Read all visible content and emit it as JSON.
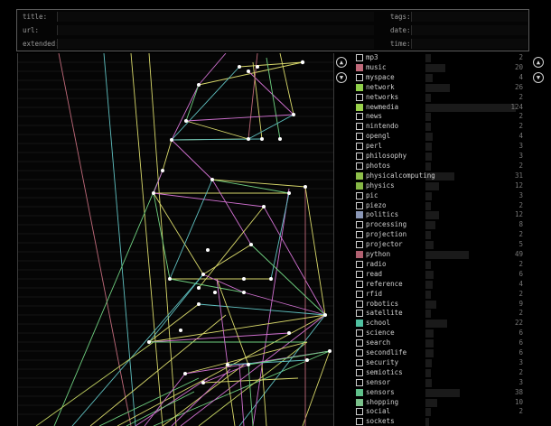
{
  "fields": {
    "title": "title:",
    "url": "url:",
    "extended": "extended:",
    "tags": "tags:",
    "date": "date:",
    "time": "time:"
  },
  "tags": [
    {
      "name": "mp3",
      "count": "2",
      "color": null
    },
    {
      "name": "music",
      "count": "20",
      "color": "#c06a7a"
    },
    {
      "name": "myspace",
      "count": "4",
      "color": null
    },
    {
      "name": "network",
      "count": "26",
      "color": "#8fcf4a"
    },
    {
      "name": "networks",
      "count": "2",
      "color": null
    },
    {
      "name": "newmedia",
      "count": "124",
      "color": "#9ad24b"
    },
    {
      "name": "news",
      "count": "2",
      "color": null
    },
    {
      "name": "nintendo",
      "count": "2",
      "color": null
    },
    {
      "name": "opengl",
      "count": "4",
      "color": null
    },
    {
      "name": "perl",
      "count": "3",
      "color": null
    },
    {
      "name": "philosophy",
      "count": "3",
      "color": null
    },
    {
      "name": "photos",
      "count": "2",
      "color": null
    },
    {
      "name": "physicalcomputing",
      "count": "31",
      "color": "#8fc04a"
    },
    {
      "name": "physics",
      "count": "12",
      "color": "#86b745"
    },
    {
      "name": "pic",
      "count": "3",
      "color": null
    },
    {
      "name": "piezo",
      "count": "2",
      "color": null
    },
    {
      "name": "politics",
      "count": "12",
      "color": "#8a97b6"
    },
    {
      "name": "processing",
      "count": "8",
      "color": null
    },
    {
      "name": "projection",
      "count": "2",
      "color": null
    },
    {
      "name": "projector",
      "count": "5",
      "color": null
    },
    {
      "name": "python",
      "count": "49",
      "color": "#b06070"
    },
    {
      "name": "radio",
      "count": "2",
      "color": null
    },
    {
      "name": "read",
      "count": "6",
      "color": null
    },
    {
      "name": "reference",
      "count": "4",
      "color": null
    },
    {
      "name": "rfid",
      "count": "2",
      "color": null
    },
    {
      "name": "robotics",
      "count": "9",
      "color": null
    },
    {
      "name": "satellite",
      "count": "2",
      "color": null
    },
    {
      "name": "school",
      "count": "22",
      "color": "#4fc0a0"
    },
    {
      "name": "science",
      "count": "6",
      "color": null
    },
    {
      "name": "search",
      "count": "6",
      "color": null
    },
    {
      "name": "secondlife",
      "count": "6",
      "color": null
    },
    {
      "name": "security",
      "count": "3",
      "color": null
    },
    {
      "name": "semiotics",
      "count": "2",
      "color": null
    },
    {
      "name": "sensor",
      "count": "3",
      "color": null
    },
    {
      "name": "sensors",
      "count": "38",
      "color": "#5fc08a"
    },
    {
      "name": "shopping",
      "count": "10",
      "color": "#7ac08a"
    },
    {
      "name": "social",
      "count": "2",
      "color": null
    },
    {
      "name": "sockets",
      "count": "",
      "color": null
    }
  ],
  "icons": {
    "graph_up": "up-arrow-icon",
    "graph_down": "down-arrow-icon",
    "list_up": "up-arrow-icon",
    "list_down": "down-arrow-icon"
  }
}
